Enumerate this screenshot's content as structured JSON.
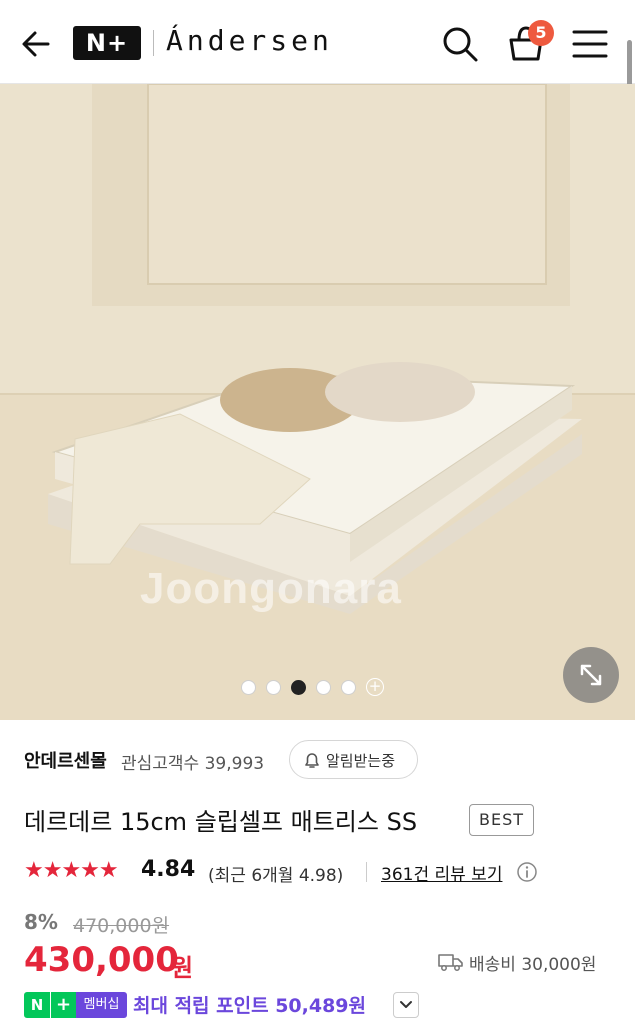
{
  "header": {
    "nplus_logo": "N+",
    "brand": "Ándersen",
    "cart_count": "5"
  },
  "hero": {
    "watermark": "Joongonara",
    "image_count": 5,
    "current_image": 3
  },
  "store": {
    "name": "안데르센몰",
    "follower_label": "관심고객수 39,993",
    "follow_button": "알림받는중"
  },
  "product": {
    "title": "데르데르 15cm 슬립셀프 매트리스 SS",
    "badge": "BEST",
    "stars": "★★★★★",
    "rating": "4.84",
    "recent_rating": "(최근 6개월 4.98)",
    "review_link": "361건 리뷰 보기",
    "discount": "8%",
    "original_price": "470,000원",
    "price": "430,000",
    "price_unit": "원",
    "shipping": "배송비 30,000원"
  },
  "points": {
    "badge_n": "N",
    "badge_plus": "+",
    "badge_label": "멤버십",
    "text": "최대 적립 포인트 50,489원"
  },
  "colors": {
    "accent_red": "#e4263b",
    "membership_purple": "#6b47dc",
    "naver_green": "#03c75a",
    "cart_badge": "#ee5a3f"
  }
}
